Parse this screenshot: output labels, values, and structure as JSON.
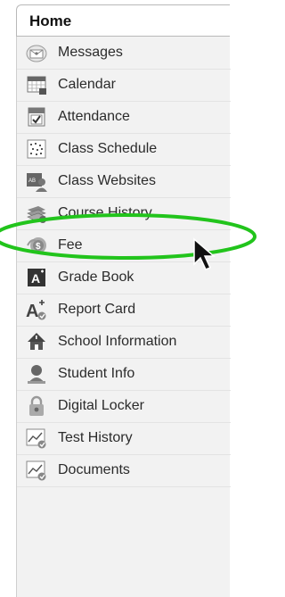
{
  "header": {
    "title": "Home"
  },
  "menu": {
    "items": [
      {
        "label": "Messages",
        "icon": "envelope-icon"
      },
      {
        "label": "Calendar",
        "icon": "calendar-icon"
      },
      {
        "label": "Attendance",
        "icon": "attendance-check-icon"
      },
      {
        "label": "Class Schedule",
        "icon": "schedule-grid-icon"
      },
      {
        "label": "Class Websites",
        "icon": "class-website-icon"
      },
      {
        "label": "Course History",
        "icon": "books-stack-icon"
      },
      {
        "label": "Fee",
        "icon": "fee-coin-icon"
      },
      {
        "label": "Grade Book",
        "icon": "grade-book-icon"
      },
      {
        "label": "Report Card",
        "icon": "report-card-icon"
      },
      {
        "label": "School Information",
        "icon": "school-building-icon"
      },
      {
        "label": "Student Info",
        "icon": "student-person-icon"
      },
      {
        "label": "Digital Locker",
        "icon": "padlock-icon"
      },
      {
        "label": "Test History",
        "icon": "test-chart-icon"
      },
      {
        "label": "Documents",
        "icon": "document-chart-icon"
      }
    ]
  },
  "colors": {
    "highlight_ring": "#22c41c",
    "menu_background": "#f2f2f2",
    "text": "#2b2b2b"
  }
}
